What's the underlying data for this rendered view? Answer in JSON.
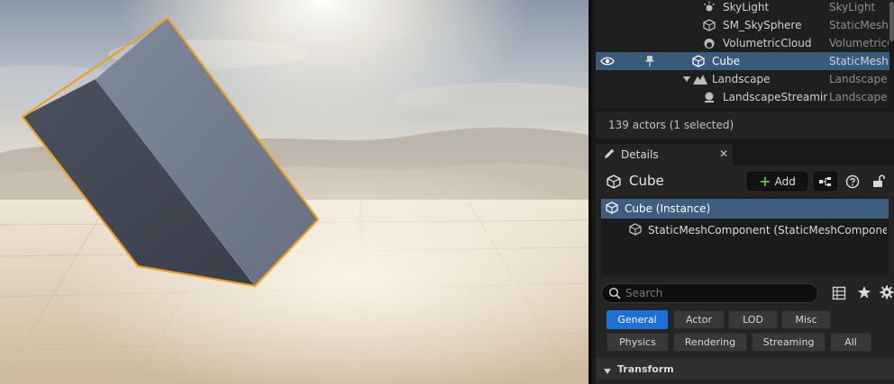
{
  "outliner": {
    "rows": [
      {
        "name": "SkyLight",
        "type": "SkyLight",
        "icon": "skylight-icon"
      },
      {
        "name": "SM_SkySphere",
        "type": "StaticMesh",
        "icon": "static-mesh-icon"
      },
      {
        "name": "VolumetricCloud",
        "type": "VolumetricC",
        "icon": "cloud-icon"
      },
      {
        "name": "Cube",
        "type": "StaticMesh",
        "icon": "static-mesh-icon",
        "selected": true
      },
      {
        "name": "Landscape",
        "type": "Landscape",
        "icon": "landscape-icon"
      },
      {
        "name": "LandscapeStreamin",
        "type": "Landscape",
        "icon": "landscape-streaming-icon"
      }
    ],
    "actor_count": "139 actors (1 selected)"
  },
  "details": {
    "tab_label": "Details",
    "close_glyph": "✕",
    "object_name": "Cube",
    "add_label": "Add",
    "components": [
      {
        "label": "Cube (Instance)",
        "selected": true
      },
      {
        "label": "StaticMeshComponent (StaticMeshComponent)",
        "selected": false
      }
    ],
    "search_placeholder": "Search",
    "filters": {
      "row1": [
        "General",
        "Actor",
        "LOD",
        "Misc"
      ],
      "row2": [
        "Physics",
        "Rendering",
        "Streaming",
        "All"
      ],
      "active": "General"
    },
    "section_transform": "Transform"
  },
  "colors": {
    "selection_outline": "#f0a020",
    "accent": "#1e6fd8",
    "add_plus": "#5dbb36"
  }
}
